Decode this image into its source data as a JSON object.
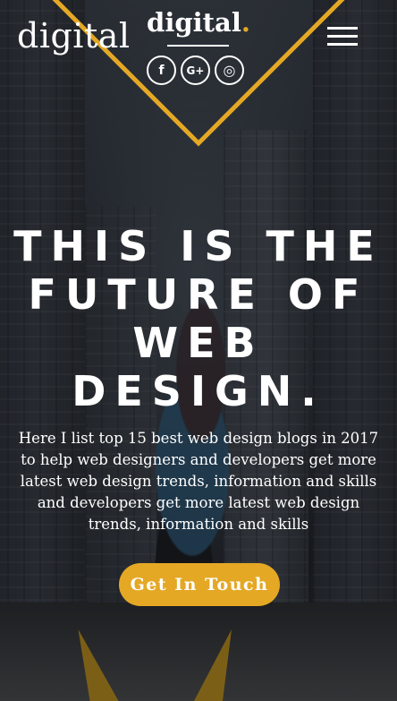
{
  "header": {
    "logo_left": "digital",
    "logo_center": "digital",
    "logo_center_dot": ".",
    "social": [
      {
        "icon": "facebook-icon",
        "glyph": "f"
      },
      {
        "icon": "google-plus-icon",
        "glyph": "G+"
      },
      {
        "icon": "instagram-icon",
        "glyph": "◎"
      }
    ],
    "menu_icon": "hamburger-menu-icon"
  },
  "hero": {
    "headline_lines": [
      "THIS IS THE",
      "FUTURE OF",
      "WEB",
      "DESIGN."
    ],
    "description": "Here I list top 15 best web design blogs in 2017 to help web designers and developers get more latest web design trends, information and skills and developers get more latest web design trends, information and skills",
    "cta_label": "Get In Touch"
  },
  "colors": {
    "accent": "#e5a825",
    "text": "#ffffff"
  }
}
